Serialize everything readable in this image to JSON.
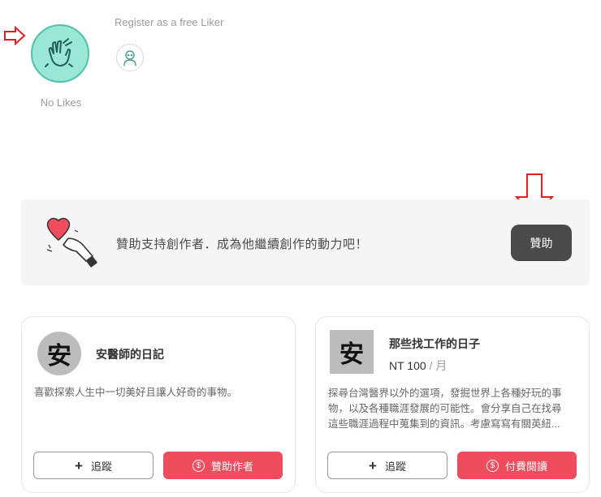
{
  "like": {
    "count_label": "No Likes",
    "register_text": "Register as a free Liker"
  },
  "banner": {
    "text": "贊助支持創作者．成為他繼續創作的動力吧！",
    "button": "贊助"
  },
  "cards": [
    {
      "avatar_char": "安",
      "title": "安醫師的日記",
      "description": "喜歡探索人生中一切美好且讓人好奇的事物。",
      "follow_label": "追蹤",
      "action_label": "贊助作者"
    },
    {
      "avatar_char": "安",
      "title": "那些找工作的日子",
      "price": "NT 100",
      "price_unit": " / 月",
      "description_lines": [
        "探尋台灣醫界以外的選項，發掘世界上各種好玩的事",
        "物，以及各種職涯發展的可能性。會分享自己在找尋",
        "這些職涯過程中蒐集到的資訊。考慮寫寫有關英紐..."
      ],
      "follow_label": "追蹤",
      "action_label": "付費閱讀"
    }
  ],
  "colors": {
    "accent_red": "#ef4c5e",
    "like_green": "#9be7d6",
    "arrow_red": "#e02020"
  }
}
